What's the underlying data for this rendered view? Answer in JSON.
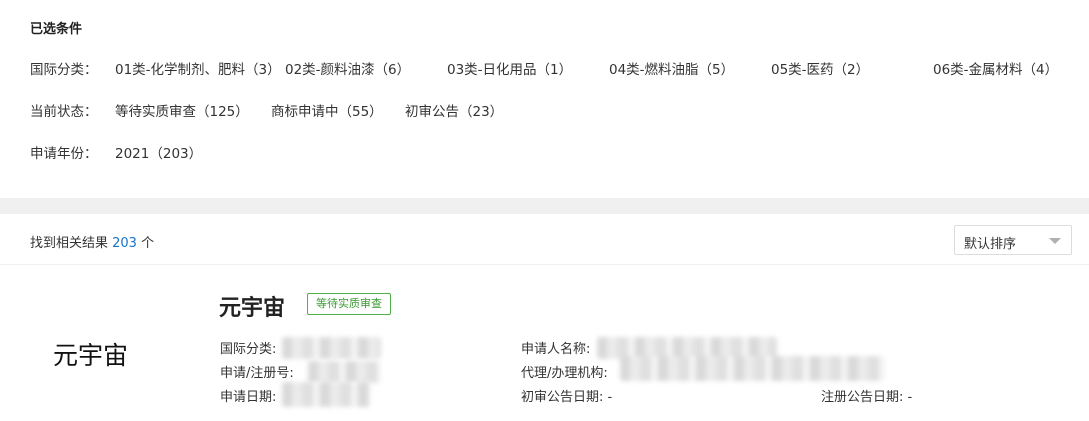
{
  "filters": {
    "title": "已选条件",
    "intl_class": {
      "label": "国际分类：",
      "options": [
        "01类-化学制剂、肥料（3）",
        "02类-颜料油漆（6）",
        "03类-日化用品（1）",
        "04类-燃料油脂（5）",
        "05类-医药（2）",
        "06类-金属材料（4）"
      ]
    },
    "status": {
      "label": "当前状态：",
      "options": [
        "等待实质审查（125）",
        "商标申请中（55）",
        "初审公告（23）"
      ]
    },
    "year": {
      "label": "申请年份：",
      "options": [
        "2021（203）"
      ]
    }
  },
  "results": {
    "prefix": "找到相关结果 ",
    "count": "203",
    "suffix": " 个",
    "sort": {
      "selected": "默认排序"
    }
  },
  "card": {
    "logo_text": "元宇宙",
    "name": "元宇宙",
    "badge": "等待实质审查",
    "fields": {
      "intl_class_label": "国际分类:",
      "reg_no_label": "申请/注册号:",
      "apply_date_label": "申请日期:",
      "applicant_label": "申请人名称:",
      "agency_label": "代理/办理机构:",
      "prelim_date_label": "初审公告日期:",
      "prelim_date_value": "-",
      "reg_date_label": "注册公告日期:",
      "reg_date_value": "-"
    }
  }
}
